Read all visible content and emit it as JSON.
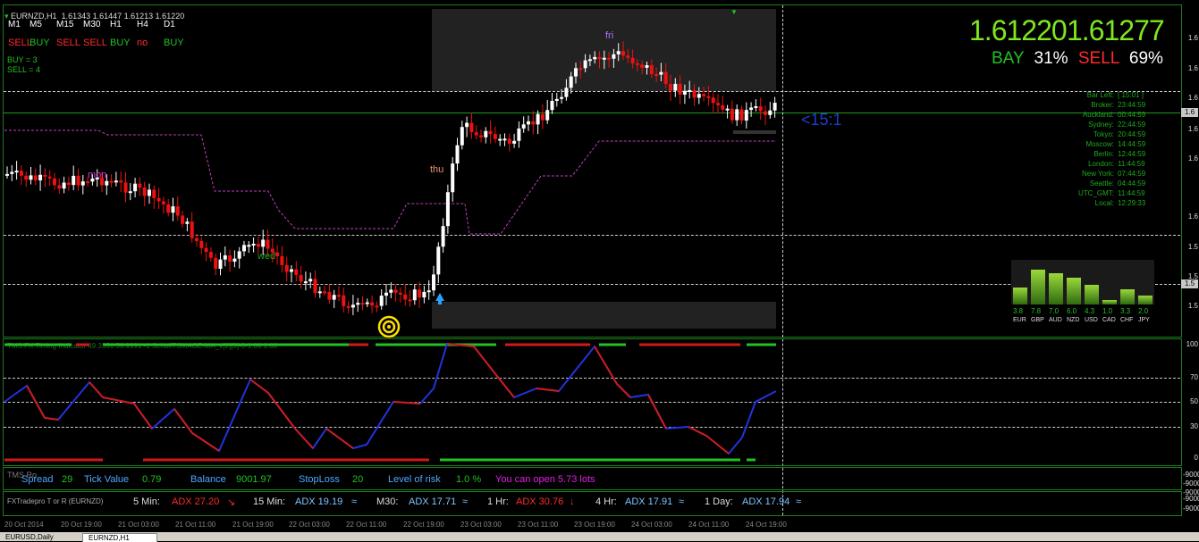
{
  "chart": {
    "title": "EURNZD,H1",
    "ohlc": "1.61343 1.61447 1.61213 1.61220",
    "timeframes": [
      "M1",
      "M5",
      "M15",
      "M30",
      "H1",
      "H4",
      "D1"
    ],
    "signals": [
      {
        "text": "SELL",
        "color": "#ff2a2a"
      },
      {
        "text": "BUY",
        "color": "#22c022"
      },
      {
        "text": "SELL",
        "color": "#ff2a2a"
      },
      {
        "text": "SELL",
        "color": "#ff2a2a"
      },
      {
        "text": "BUY",
        "color": "#22c022"
      },
      {
        "text": "no",
        "color": "#ff2a2a"
      },
      {
        "text": "BUY",
        "color": "#22c022"
      }
    ],
    "buy_count": "BUY = 3",
    "sell_count": "SELL = 4",
    "days": {
      "mon": "mon",
      "wed": "wed",
      "thu": "thu",
      "fri": "fri"
    },
    "bid": "1.61220",
    "ask": "1.61277",
    "bay_label": "BAY",
    "bay_pct": "31%",
    "sell_label": "SELL",
    "sell_pct": "69%",
    "bar_timer": "<15:1",
    "clocks": [
      {
        "label": "Bar Left:",
        "value": "[ 15:01 ]"
      },
      {
        "label": "Broker:",
        "value": "23:44:59"
      },
      {
        "label": "Auckland:",
        "value": "00:44:59"
      },
      {
        "label": "Sydney:",
        "value": "22:44:59"
      },
      {
        "label": "Tokyo:",
        "value": "20:44:59"
      },
      {
        "label": "Moscow:",
        "value": "14:44:59"
      },
      {
        "label": "Berlin:",
        "value": "12:44:59"
      },
      {
        "label": "London:",
        "value": "11:44:59"
      },
      {
        "label": "New York:",
        "value": "07:44:59"
      },
      {
        "label": "Seattle:",
        "value": "04:44:59"
      },
      {
        "label": "UTC_GMT:",
        "value": "11:44:59"
      },
      {
        "label": "Local:",
        "value": "12:29:33"
      }
    ],
    "strength": [
      {
        "ccy": "EUR",
        "val": "3.8",
        "level": 0.38
      },
      {
        "ccy": "GBP",
        "val": "7.8",
        "level": 0.78
      },
      {
        "ccy": "AUD",
        "val": "7.0",
        "level": 0.7
      },
      {
        "ccy": "NZD",
        "val": "6.0",
        "level": 0.6
      },
      {
        "ccy": "USD",
        "val": "4.3",
        "level": 0.43
      },
      {
        "ccy": "CAD",
        "val": "1.0",
        "level": 0.1
      },
      {
        "ccy": "CHF",
        "val": "3.3",
        "level": 0.33
      },
      {
        "ccy": "JPY",
        "val": "2.0",
        "level": 0.2
      }
    ],
    "price_axis": [
      "1.6",
      "1.6",
      "1.6",
      "1.6",
      "1.6",
      "1.6",
      "1.6",
      "1.5",
      "1.5",
      "1.5",
      "1.5"
    ]
  },
  "indicator": {
    "label": "TMS FX Timing Indicator 49.3351 59.9991 -1 SchaffTSMAGE-MA_v[2][3]-8-1.00 1.00",
    "axis": [
      "100",
      "70",
      "50",
      "30",
      "0"
    ]
  },
  "status": {
    "tag": "TMS Ro",
    "spread_label": "Spread",
    "spread": "29",
    "tick_label": "Tick Value",
    "tick": "0.79",
    "balance_label": "Balance",
    "balance": "9001.97",
    "stoploss_label": "StopLoss",
    "stoploss": "20",
    "risk_label": "Level of risk",
    "risk": "1.0 %",
    "lots": "You can open 5.73 lots",
    "axis": [
      "-9000",
      "-9000",
      "-9000"
    ]
  },
  "adx": {
    "tag": "FXTradepro T or R (EURNZD)",
    "items": [
      {
        "tf": "5 Min:",
        "value": "ADX 27.20",
        "arrow": "↘",
        "color": "#ff2a2a"
      },
      {
        "tf": "15 Min:",
        "value": "ADX 19.19",
        "arrow": "≈",
        "color": "#7ec4ff"
      },
      {
        "tf": "M30:",
        "value": "ADX 17.71",
        "arrow": "≈",
        "color": "#7ec4ff"
      },
      {
        "tf": "1 Hr:",
        "value": "ADX 30.76",
        "arrow": "↓",
        "color": "#ff2a2a"
      },
      {
        "tf": "4 Hr:",
        "value": "ADX 17.91",
        "arrow": "≈",
        "color": "#7ec4ff"
      },
      {
        "tf": "1 Day:",
        "value": "ADX 17.94",
        "arrow": "≈",
        "color": "#7ec4ff"
      }
    ],
    "axis": [
      "-9000",
      "-9000"
    ]
  },
  "time_axis": [
    "20 Oct 2014",
    "20 Oct 19:00",
    "21 Oct 03:00",
    "21 Oct 11:00",
    "21 Oct 19:00",
    "22 Oct 03:00",
    "22 Oct 11:00",
    "22 Oct 19:00",
    "23 Oct 03:00",
    "23 Oct 11:00",
    "23 Oct 19:00",
    "24 Oct 03:00",
    "24 Oct 11:00",
    "24 Oct 19:00"
  ],
  "tabs": [
    {
      "label": "EURUSD,Daily",
      "active": false
    },
    {
      "label": "EURNZD,H1",
      "active": true
    }
  ],
  "colors": {
    "bull": "#ffffff",
    "bear": "#ee1111",
    "grid": "#1e7d1e",
    "buy": "#22c022",
    "sell": "#ff2a2a",
    "accent": "#7ee81e"
  }
}
